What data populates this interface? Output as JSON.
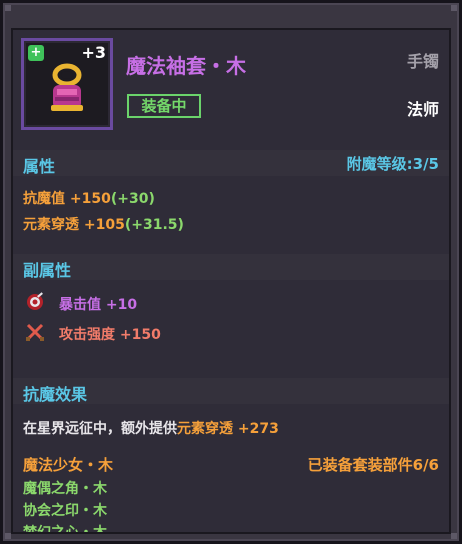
{
  "item": {
    "name": "魔法袖套・木",
    "level": "+3",
    "slot": "手镯",
    "equipped_label": "装备中",
    "class": "法师"
  },
  "attributes": {
    "title": "属性",
    "enchant_label": "附魔等级:3/5",
    "lines": [
      {
        "name": "抗魔值",
        "value": "+150",
        "bonus": "(+30)"
      },
      {
        "name": "元素穿透",
        "value": "+105",
        "bonus": "(+31.5)"
      }
    ]
  },
  "sub_attributes": {
    "title": "副属性",
    "lines": [
      {
        "icon": "crit-target-icon",
        "name": "暴击值",
        "value": "+10"
      },
      {
        "icon": "crossed-swords-icon",
        "name": "攻击强度",
        "value": "+150"
      }
    ]
  },
  "anti_magic": {
    "title": "抗魔效果",
    "text_prefix": "在星界远征中，额外提供",
    "text_stat": "元素穿透",
    "text_value": "+273"
  },
  "set": {
    "title": "魔法少女・木",
    "count_label": "已装备套装部件6/6",
    "pieces": [
      "魔偶之角・木",
      "协会之印・木",
      "梦幻之心・木"
    ]
  },
  "colors": {
    "title_purple": "#c76fe6",
    "section_cyan": "#5ac7e6",
    "value_orange": "#f5a03a",
    "bonus_green": "#8bd86c",
    "equipped_green": "#74d86a"
  }
}
